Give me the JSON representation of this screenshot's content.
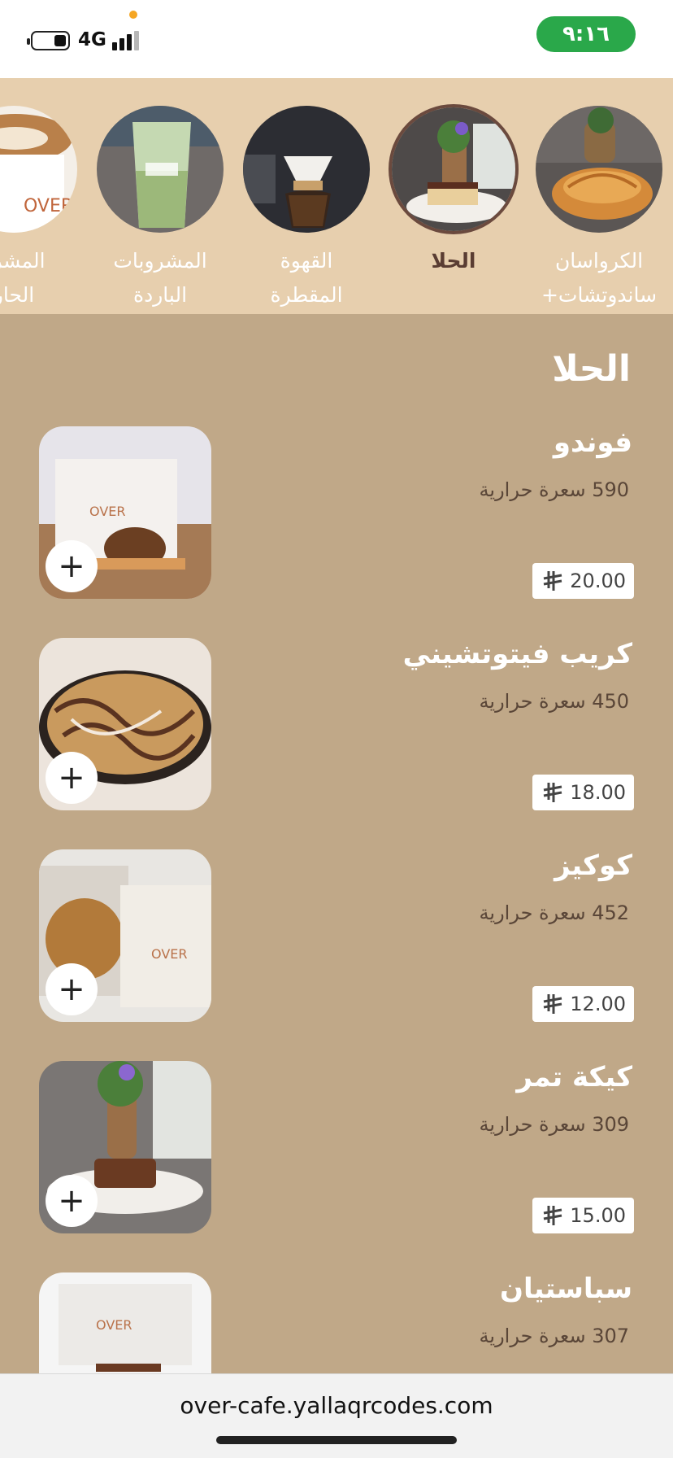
{
  "status_bar": {
    "time": "٩:١٦",
    "network": "4G"
  },
  "categories": [
    {
      "label": "الكرواسان\n+ساندوتشات",
      "active": false,
      "icon": "croissant-photo"
    },
    {
      "label": "الحلا",
      "active": true,
      "icon": "dessert-photo"
    },
    {
      "label": "القهوة\nالمقطرة",
      "active": false,
      "icon": "drip-coffee-photo"
    },
    {
      "label": "المشروبات\nالباردة",
      "active": false,
      "icon": "iced-drink-photo"
    },
    {
      "label": "المشرو\nالحار",
      "active": false,
      "icon": "latte-photo"
    }
  ],
  "section": {
    "title": "الحلا"
  },
  "items": [
    {
      "name": "فوندو",
      "calories": "590 سعرة حرارية",
      "price": "20.00"
    },
    {
      "name": "كريب فيتوتشيني",
      "calories": "450 سعرة حرارية",
      "price": "18.00"
    },
    {
      "name": "كوكيز",
      "calories": "452 سعرة حرارية",
      "price": "12.00"
    },
    {
      "name": "كيكة تمر",
      "calories": "309 سعرة حرارية",
      "price": "15.00"
    },
    {
      "name": "سباستيان",
      "calories": "307 سعرة حرارية",
      "price": ""
    }
  ],
  "add_button_label": "+",
  "browser": {
    "url": "over-cafe.yallaqrcodes.com"
  },
  "colors": {
    "page_bg": "#c0a888",
    "category_bg": "#e7cfae",
    "time_pill": "#2aa84a",
    "active_category": "#5a3d33"
  }
}
